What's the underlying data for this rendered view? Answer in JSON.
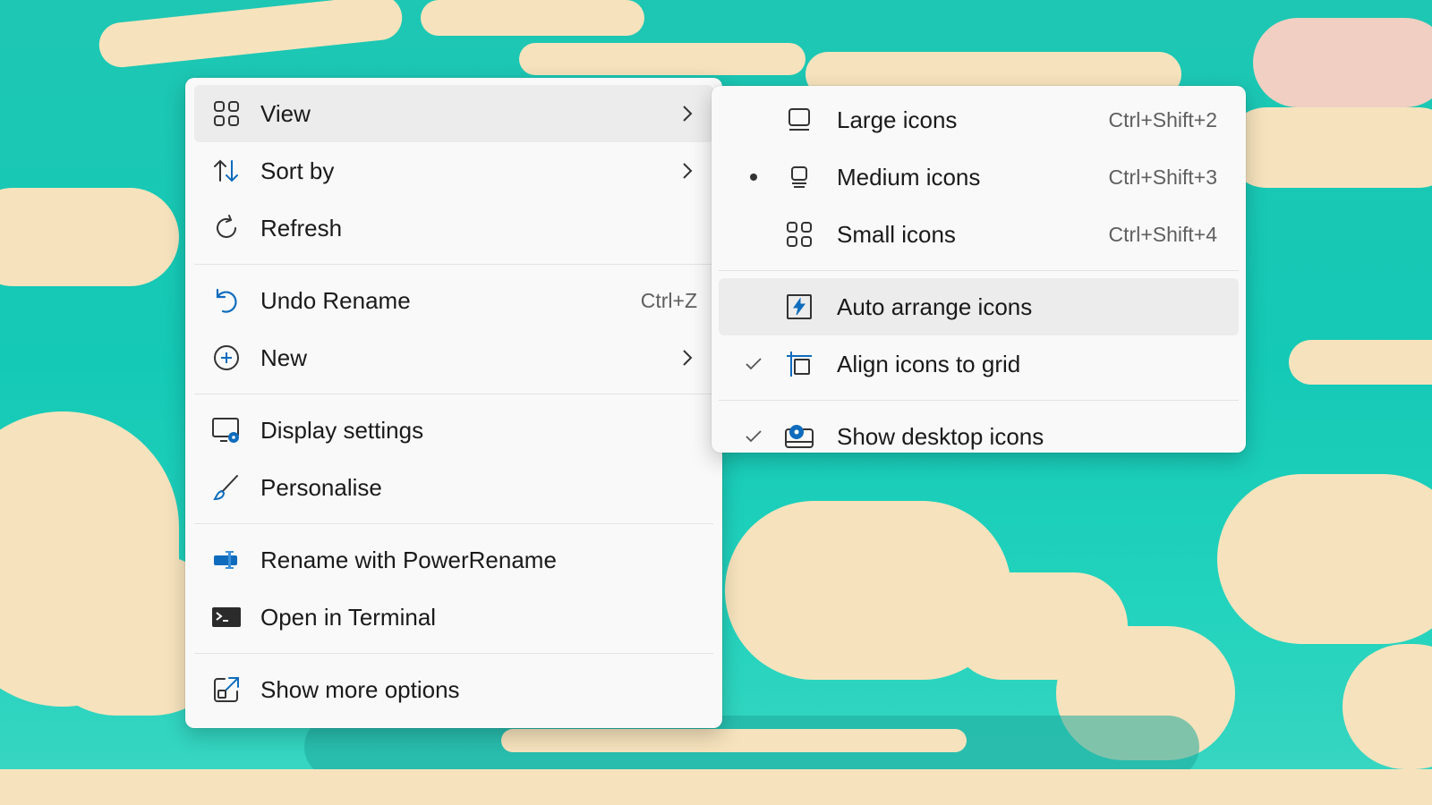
{
  "context_menu": {
    "items": [
      {
        "label": "View",
        "icon": "grid-icon",
        "has_submenu": true
      },
      {
        "label": "Sort by",
        "icon": "sort-icon",
        "has_submenu": true
      },
      {
        "label": "Refresh",
        "icon": "refresh-icon"
      },
      {
        "label": "Undo Rename",
        "icon": "undo-icon",
        "shortcut": "Ctrl+Z"
      },
      {
        "label": "New",
        "icon": "plus-circle-icon",
        "has_submenu": true
      },
      {
        "label": "Display settings",
        "icon": "display-settings-icon"
      },
      {
        "label": "Personalise",
        "icon": "brush-icon"
      },
      {
        "label": "Rename with PowerRename",
        "icon": "powerrename-icon"
      },
      {
        "label": "Open in Terminal",
        "icon": "terminal-icon"
      },
      {
        "label": "Show more options",
        "icon": "external-icon"
      }
    ]
  },
  "view_submenu": {
    "items": [
      {
        "label": "Large icons",
        "icon": "large-icons-icon",
        "shortcut": "Ctrl+Shift+2",
        "mark": ""
      },
      {
        "label": "Medium icons",
        "icon": "medium-icons-icon",
        "shortcut": "Ctrl+Shift+3",
        "mark": "bullet"
      },
      {
        "label": "Small icons",
        "icon": "small-icons-icon",
        "shortcut": "Ctrl+Shift+4",
        "mark": ""
      },
      {
        "label": "Auto arrange icons",
        "icon": "auto-arrange-icon",
        "mark": ""
      },
      {
        "label": "Align icons to grid",
        "icon": "align-grid-icon",
        "mark": "check"
      },
      {
        "label": "Show desktop icons",
        "icon": "show-desktop-icon",
        "mark": "check"
      }
    ]
  },
  "colors": {
    "accent": "#0f6cbd",
    "menu_bg": "#f9f9f9",
    "highlight": "#ececec",
    "wallpaper_teal": "#1ec7b3",
    "wallpaper_cloud": "#f6e3bd"
  }
}
